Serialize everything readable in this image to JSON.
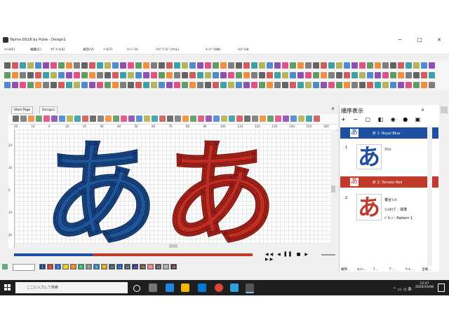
{
  "window": {
    "title": "Tajima DG16 by Pulse - Design1"
  },
  "menu": [
    "ﾌｧｲﾙ(F)",
    "編集(E)",
    "ｾｸﾞﾒﾝﾄ(S)",
    "表示(V)",
    "ﾂｰﾙ(T)",
    "ｲﾒｰｼﾞ(I)",
    "ﾗｲﾌﾞﾌﾟﾛｼﾞｪｸﾄ(L)",
    "ｳｨﾝﾄﾞｳ(W)",
    "ﾍﾙﾌﾟ(H)"
  ],
  "tabs": [
    {
      "label": "Start Page"
    },
    {
      "label": "Design1"
    }
  ],
  "ruler": {
    "top": [
      "20",
      "10",
      "0",
      "10",
      "20",
      "30",
      "40",
      "50",
      "60",
      "70",
      "80",
      "90",
      "100",
      "110",
      "120",
      "130",
      "140",
      "150",
      "160"
    ],
    "left": [
      "20",
      "10",
      "0",
      "10",
      "20"
    ]
  },
  "design": {
    "glyph": "あ",
    "colors": {
      "blue": "#1a4d8f",
      "red": "#b8271e"
    }
  },
  "panel": {
    "title": "順序表示",
    "groups": [
      {
        "header": "針 1: Royal Blue",
        "number": "1",
        "glyph": "あ",
        "type": "ﾃｷｽﾄ",
        "color": "#1e4fa0"
      },
      {
        "header": "針 2: Tomato Red",
        "number": "2",
        "glyph": "あ",
        "type": "複合ﾌｨﾙ",
        "fill_label": "ﾌｨﾙﾀｲﾌﾟ",
        "fill_value": "標準",
        "pattern_label": "ﾊﾟﾀｰﾝ",
        "pattern_value": "Pattern 1",
        "color": "#c0392b"
      }
    ],
    "bottom_tabs": [
      "順序...",
      "ｴﾚﾒﾝ...",
      "ｱ...",
      "ﾃﾞ...",
      "ｻｰﾙ...",
      "全域..."
    ]
  },
  "palette": {
    "labels": [
      "1",
      "2",
      "3",
      "4",
      "5",
      "6",
      "7",
      "8",
      "9",
      "10",
      "11",
      "12",
      "13",
      "14",
      "15",
      "16",
      "17",
      "18"
    ],
    "colors": [
      "#1e3f8a",
      "#c0392b",
      "#1565c0",
      "#f1c40f",
      "#e67e22",
      "#27ae60",
      "#7f8c8d",
      "#2980b9",
      "#d4a017",
      "#2c3e50",
      "#0d47a1",
      "#34495e",
      "#1a237e",
      "#5d4037",
      "#e57373",
      "#424242",
      "#9e9e9e",
      "#3e2723"
    ]
  },
  "taskbar": {
    "search": "ここに入力して検索",
    "time": "12:47",
    "date": "2020/10/08"
  }
}
